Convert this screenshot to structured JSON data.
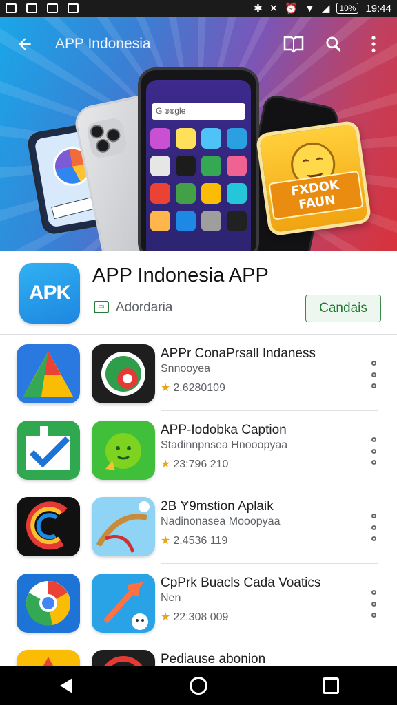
{
  "status_bar": {
    "battery": "10%",
    "time": "19:44"
  },
  "toolbar": {
    "title": "APP Indonesia"
  },
  "banner": {
    "search_text": "G 𝕠𝕠gle",
    "sticker_text": "FXDOK FAUN"
  },
  "app": {
    "icon_text": "APK",
    "title": "APP Indonesia APP",
    "developer": "Adordaria",
    "action_label": "Candais"
  },
  "list": [
    {
      "name": "APPr ConaPrsall Indaness",
      "subtitle": "Snnooyea",
      "rating": "2.6280109"
    },
    {
      "name": "APP-Iodobka Caption",
      "subtitle": "Stadinnpnsea Hnooopyaa",
      "rating": "23:796 210"
    },
    {
      "name": "2B Ɏ9mstion Aplaik",
      "subtitle": "Nadinonasea Mooopyaa",
      "rating": "2.4536 119"
    },
    {
      "name": "CpPrk Buacls Cada Voatics",
      "subtitle": "Nen",
      "rating": "22:308 009"
    },
    {
      "name": "Pediause abonion",
      "subtitle": "",
      "rating": ""
    }
  ],
  "colors": {
    "accent_green": "#1e7a33",
    "star": "#e8a317",
    "app_icon_blue": "#1d86e0"
  }
}
